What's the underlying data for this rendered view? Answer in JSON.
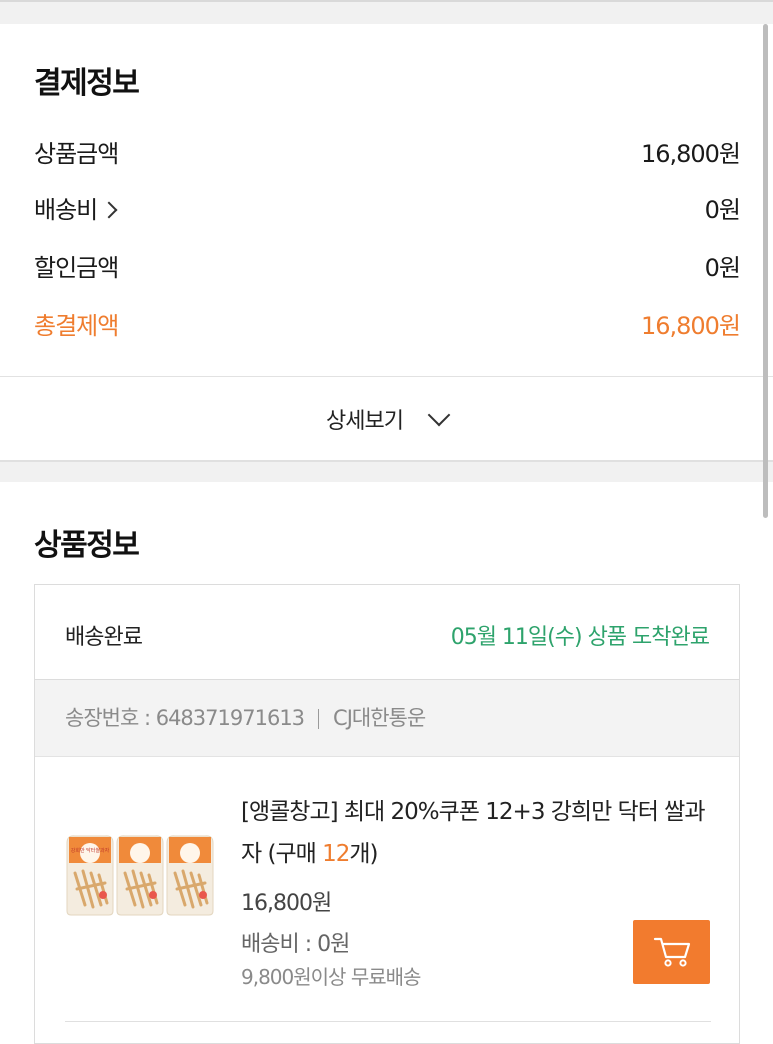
{
  "payment": {
    "title": "결제정보",
    "rows": [
      {
        "label": "상품금액",
        "value": "16,800원"
      },
      {
        "label": "배송비",
        "value": "0원"
      },
      {
        "label": "할인금액",
        "value": "0원"
      },
      {
        "label": "총결제액",
        "value": "16,800원"
      }
    ],
    "detail_label": "상세보기"
  },
  "product_section": {
    "title": "상품정보",
    "status": "배송완료",
    "status_date": "05월 11일(수) 상품 도착완료",
    "invoice_label": "송장번호 : 648371971613",
    "courier": "CJ대한통운",
    "item": {
      "name_prefix": "[앵콜창고] 최대 20%쿠폰 12+3 강희만 닥터 쌀과자 (구매 ",
      "qty": "12",
      "name_suffix": "개)",
      "price": "16,800원",
      "shipping": "배송비 : 0원",
      "free_shipping": "9,800원이상 무료배송",
      "package_text": "강희만 닥터쌀과자"
    }
  },
  "colors": {
    "accent": "#ef7d2f",
    "status_green": "#2ea36c",
    "cart_button": "#f27b2e",
    "band_gray": "#f1f1f1"
  },
  "icons": [
    "chevron-right-icon",
    "chevron-down-icon",
    "cart-icon"
  ]
}
